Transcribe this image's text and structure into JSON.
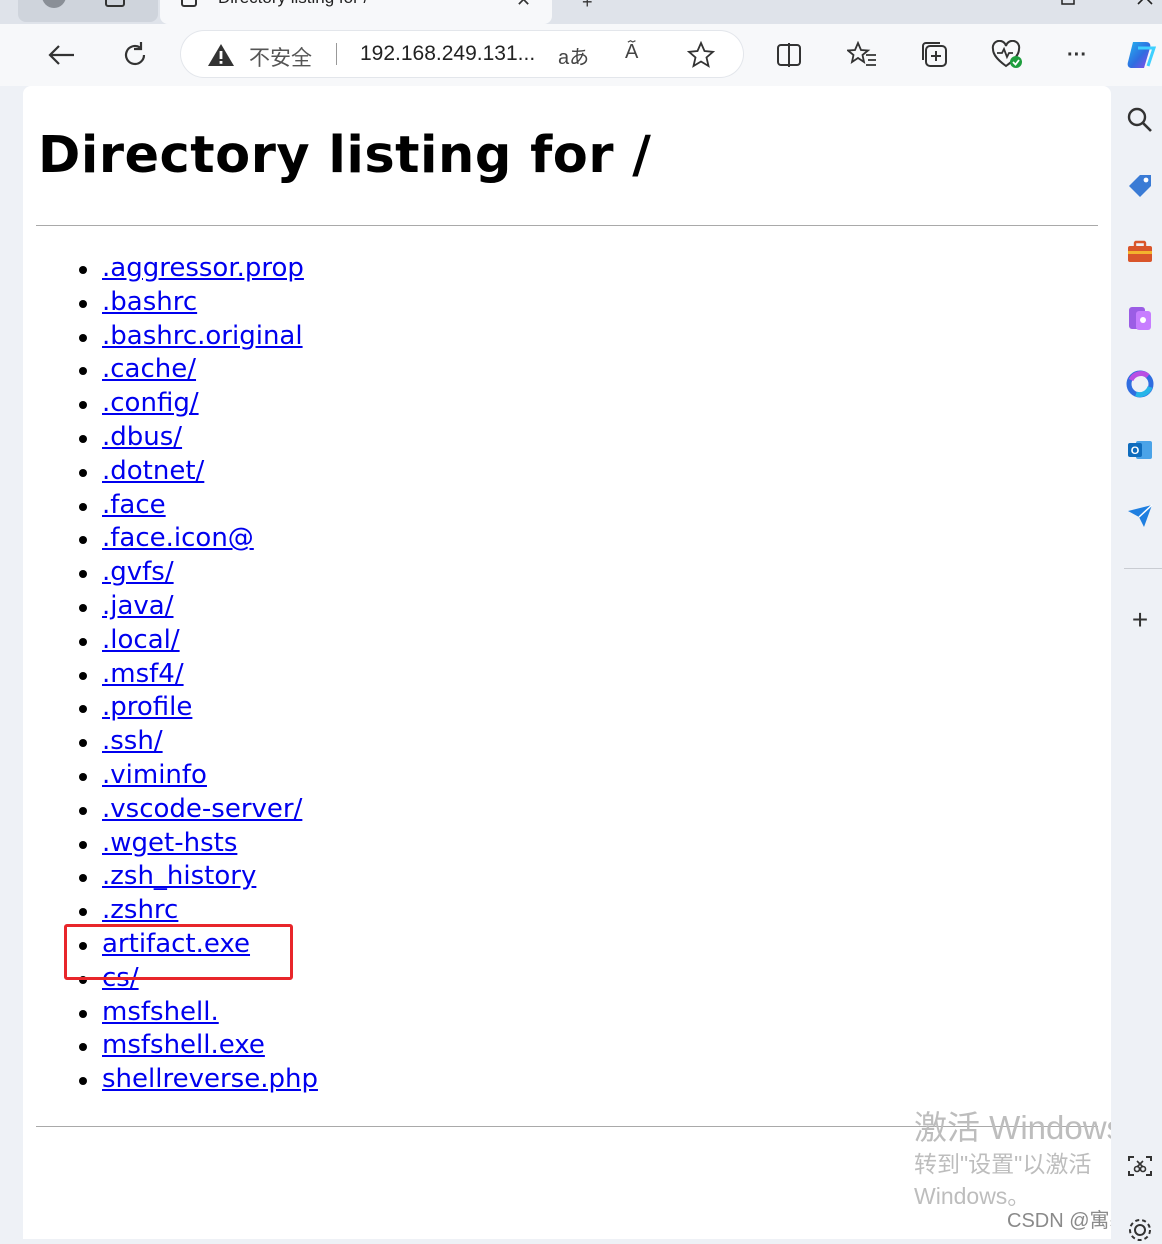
{
  "browser": {
    "tab_title": "Directory listing for /",
    "close_glyph": "✕",
    "new_tab_glyph": "+",
    "address": {
      "security_label": "不安全",
      "url": "192.168.249.131...",
      "translate_glyph": "aあ",
      "read_aloud_glyph": "A᷉"
    },
    "more_glyph": "···"
  },
  "page": {
    "heading": "Directory listing for /",
    "files": [
      ".aggressor.prop",
      ".bashrc",
      ".bashrc.original",
      ".cache/",
      ".config/",
      ".dbus/",
      ".dotnet/",
      ".face",
      ".face.icon@",
      ".gvfs/",
      ".java/",
      ".local/",
      ".msf4/",
      ".profile",
      ".ssh/",
      ".viminfo",
      ".vscode-server/",
      ".wget-hsts",
      ".zsh_history",
      ".zshrc",
      "artifact.exe",
      "cs/",
      "msfshell.",
      "msfshell.exe",
      "shellreverse.php"
    ],
    "highlighted_file": "artifact.exe",
    "highlight_color": "#e8262a",
    "link_color": "#0000ee"
  },
  "watermark": {
    "line1": "激活 Windows",
    "line2": "转到\"设置\"以激活",
    "line3": "Windows。",
    "credit": "CSDN @寓寒星"
  },
  "sidebar": {
    "icons": [
      "search-icon",
      "tag-icon",
      "toolbox-icon",
      "games-icon",
      "microsoft365-icon",
      "outlook-icon",
      "send-icon",
      "add-icon"
    ],
    "add_glyph": "+"
  }
}
